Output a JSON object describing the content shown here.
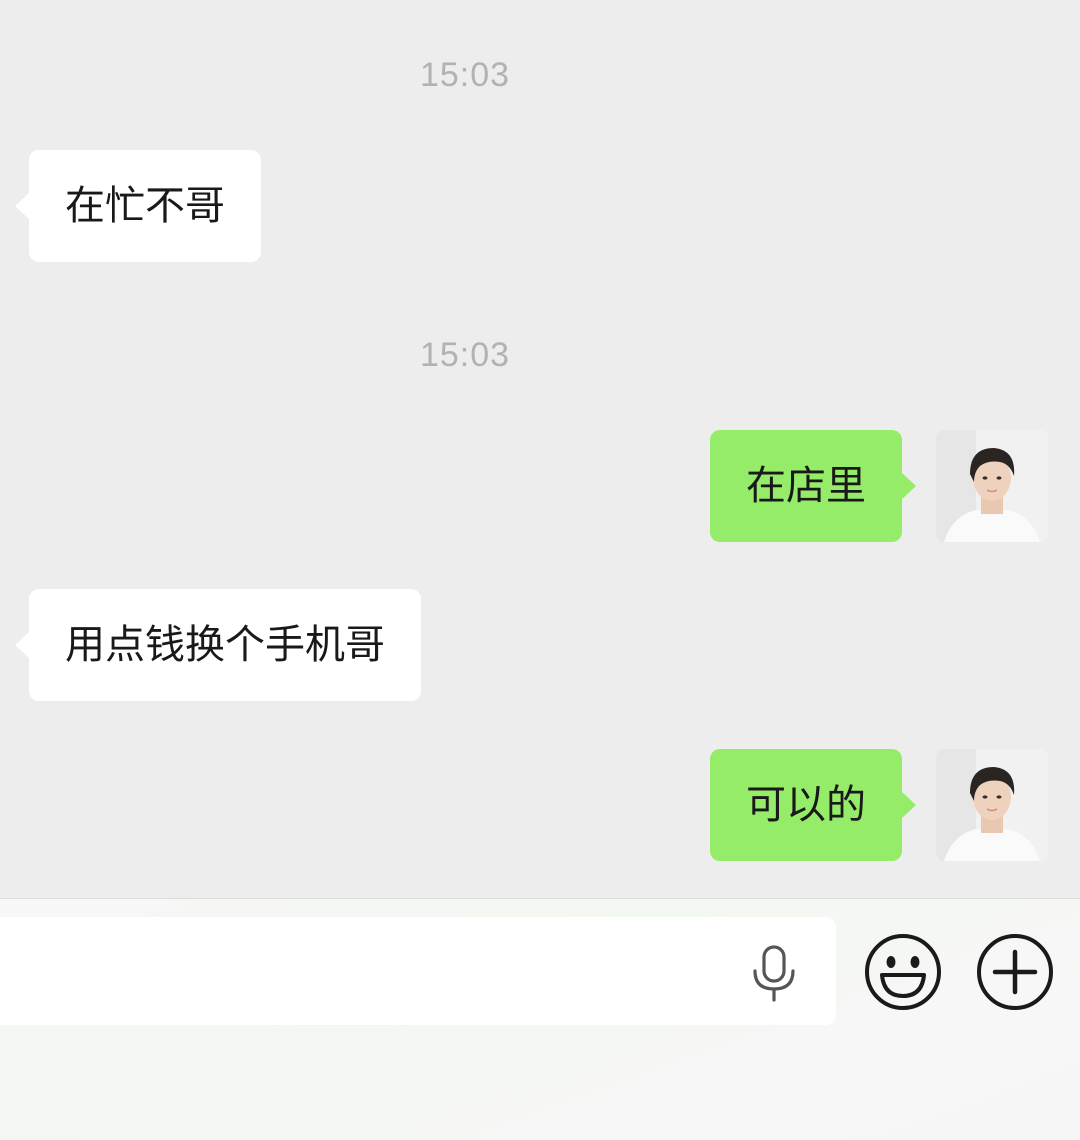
{
  "messages": [
    {
      "type": "timestamp",
      "text": "15:03"
    },
    {
      "type": "received",
      "text": "在忙不哥"
    },
    {
      "type": "timestamp",
      "text": "15:03"
    },
    {
      "type": "sent",
      "text": "在店里"
    },
    {
      "type": "received",
      "text": "用点钱换个手机哥"
    },
    {
      "type": "sent",
      "text": "可以的"
    }
  ],
  "input_bar": {
    "value": "",
    "placeholder": "",
    "icons": [
      "microphone-icon",
      "emoji-icon",
      "plus-icon"
    ]
  },
  "colors": {
    "chat_background": "#EDEDED",
    "sent_bubble": "#95EC69",
    "received_bubble": "#FFFFFF",
    "timestamp_text": "#B2B2B2",
    "message_text": "#191919"
  }
}
